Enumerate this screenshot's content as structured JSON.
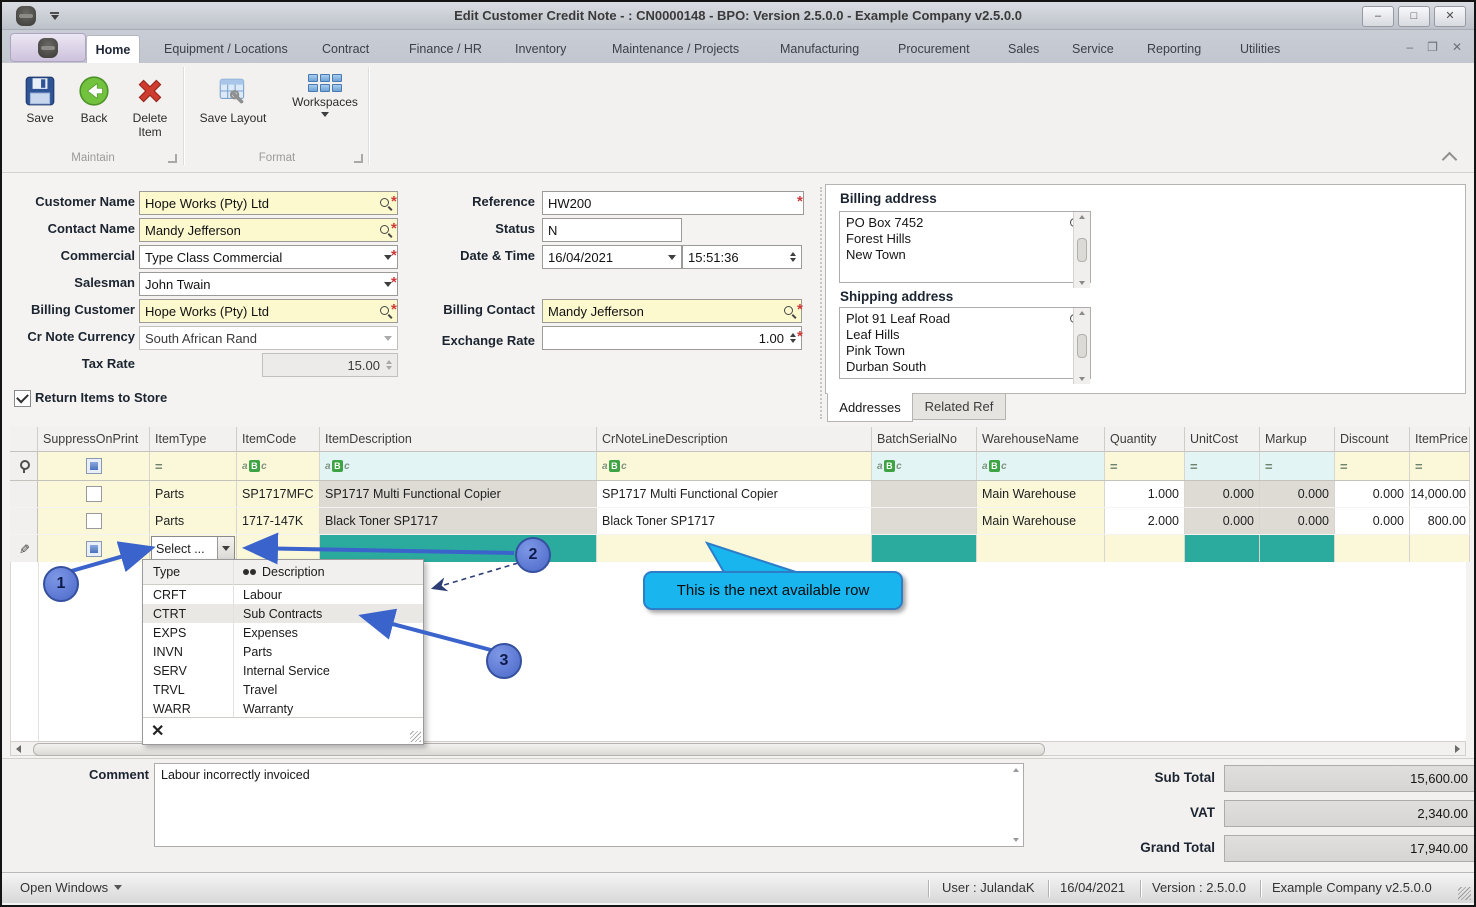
{
  "titlebar": {
    "title": "Edit Customer Credit Note - : CN0000148 - BPO: Version 2.5.0.0 - Example Company v2.5.0.0"
  },
  "window_controls": {
    "minimize": "–",
    "maximize": "□",
    "close": "✕",
    "mdi_minimize": "–",
    "mdi_restore": "❐",
    "mdi_close": "✕"
  },
  "tabs": [
    "Home",
    "Equipment / Locations",
    "Contract",
    "Finance / HR",
    "Inventory",
    "Maintenance / Projects",
    "Manufacturing",
    "Procurement",
    "Sales",
    "Service",
    "Reporting",
    "Utilities"
  ],
  "ribbon": {
    "save": "Save",
    "back": "Back",
    "delete_item": "Delete Item",
    "save_layout": "Save Layout",
    "workspaces": "Workspaces",
    "group_maintain": "Maintain",
    "group_format": "Format"
  },
  "form": {
    "required_marker": "*",
    "left": [
      {
        "label": "Customer Name",
        "value": "Hope Works (Pty) Ltd"
      },
      {
        "label": "Contact Name",
        "value": "Mandy Jefferson"
      },
      {
        "label": "Commercial",
        "value": "Type Class Commercial"
      },
      {
        "label": "Salesman",
        "value": "John Twain"
      },
      {
        "label": "Billing Customer",
        "value": "Hope Works (Pty) Ltd"
      },
      {
        "label": "Cr Note Currency",
        "value": "South African Rand"
      },
      {
        "label": "Tax Rate",
        "value": "15.00"
      }
    ],
    "middle": {
      "reference_label": "Reference",
      "reference": "HW200",
      "status_label": "Status",
      "status": "N",
      "datetime_label": "Date & Time",
      "date": "16/04/2021",
      "time": "15:51:36",
      "billing_contact_label": "Billing Contact",
      "billing_contact": "Mandy Jefferson",
      "exchange_rate_label": "Exchange Rate",
      "exchange_rate": "1.00"
    },
    "return_items_label": "Return Items to Store"
  },
  "addresses": {
    "billing_label": "Billing address",
    "billing_lines": [
      "PO Box 7452",
      "Forest Hills",
      "New Town"
    ],
    "shipping_label": "Shipping address",
    "shipping_lines": [
      "Plot 91 Leaf Road",
      "Leaf Hills",
      "Pink Town",
      "Durban South"
    ],
    "tab_addresses": "Addresses",
    "tab_related": "Related Ref"
  },
  "grid": {
    "columns": [
      "SuppressOnPrint",
      "ItemType",
      "ItemCode",
      "ItemDescription",
      "CrNoteLineDescription",
      "BatchSerialNo",
      "WarehouseName",
      "Quantity",
      "UnitCost",
      "Markup",
      "Discount",
      "ItemPrice"
    ],
    "filter": {
      "eq": "=",
      "abc_a": "a",
      "abc_b": "B",
      "abc_c": "c"
    },
    "rows": [
      {
        "item_type": "Parts",
        "item_code": "SP1717MFC",
        "item_description": "SP1717 Multi Functional Copier",
        "crnote_line_description": "SP1717 Multi Functional Copier",
        "batch_serial_no": "",
        "warehouse_name": "Main Warehouse",
        "quantity": "1.000",
        "unit_cost": "0.000",
        "markup": "0.000",
        "discount": "0.000",
        "item_price": "14,000.00"
      },
      {
        "item_type": "Parts",
        "item_code": "1717-147K",
        "item_description": "Black Toner SP1717",
        "crnote_line_description": "Black Toner SP1717",
        "batch_serial_no": "",
        "warehouse_name": "Main Warehouse",
        "quantity": "2.000",
        "unit_cost": "0.000",
        "markup": "0.000",
        "discount": "0.000",
        "item_price": "800.00"
      }
    ],
    "new_row": {
      "select": "Select ..."
    }
  },
  "popup": {
    "type_header": "Type",
    "description_header": "Description",
    "items": [
      {
        "code": "CRFT",
        "desc": "Labour"
      },
      {
        "code": "CTRT",
        "desc": "Sub Contracts"
      },
      {
        "code": "EXPS",
        "desc": "Expenses"
      },
      {
        "code": "INVN",
        "desc": "Parts"
      },
      {
        "code": "SERV",
        "desc": "Internal Service"
      },
      {
        "code": "TRVL",
        "desc": "Travel"
      },
      {
        "code": "WARR",
        "desc": "Warranty"
      }
    ],
    "clear": "✕"
  },
  "annotations": {
    "step1": "1",
    "step2": "2",
    "step3": "3",
    "callout": "This is the next available row"
  },
  "comment": {
    "label": "Comment",
    "value": "Labour incorrectly invoiced"
  },
  "totals": {
    "sub_total_label": "Sub Total",
    "sub_total": "15,600.00",
    "vat_label": "VAT",
    "vat": "2,340.00",
    "grand_total_label": "Grand Total",
    "grand_total": "17,940.00"
  },
  "statusbar": {
    "open_windows": "Open Windows",
    "user": "User : JulandaK",
    "date": "16/04/2021",
    "version": "Version : 2.5.0.0",
    "company": "Example Company v2.5.0.0"
  }
}
